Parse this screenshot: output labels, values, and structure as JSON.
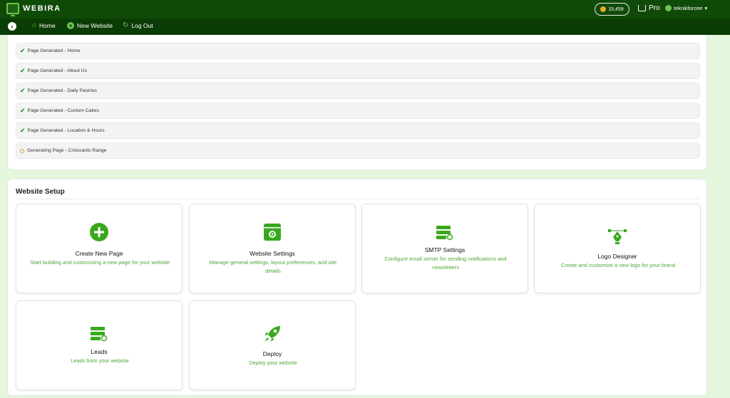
{
  "app": {
    "name": "WEBIRA",
    "credits": "15,459",
    "plan": "Pro",
    "username": "teknikforcee"
  },
  "nav": {
    "home": "Home",
    "new_website": "New Website",
    "logout": "Log Out"
  },
  "progress": [
    {
      "status": "done",
      "text": "Page Generated - Home"
    },
    {
      "status": "done",
      "text": "Page Generated - About Us"
    },
    {
      "status": "done",
      "text": "Page Generated - Daily Pastries"
    },
    {
      "status": "done",
      "text": "Page Generated - Custom Cakes"
    },
    {
      "status": "done",
      "text": "Page Generated - Location & Hours"
    },
    {
      "status": "pending",
      "text": "Generating Page - Croissants Range"
    }
  ],
  "setup": {
    "title": "Website Setup",
    "cards": [
      {
        "icon": "plus-circle-icon",
        "title": "Create New Page",
        "desc": "Start building and customizing a new page for your website"
      },
      {
        "icon": "settings-window-icon",
        "title": "Website Settings",
        "desc": "Manage general settings, layout preferences, and site details"
      },
      {
        "icon": "mail-server-icon",
        "title": "SMTP Settings",
        "desc": "Configure email server for sending notifications and newsletters"
      },
      {
        "icon": "pen-tool-icon",
        "title": "Logo Designer",
        "desc": "Create and customize a new logo for your brand"
      },
      {
        "icon": "server-icon",
        "title": "Leads",
        "desc": "Leads from your website"
      },
      {
        "icon": "rocket-icon",
        "title": "Deploy",
        "desc": "Deploy your website"
      }
    ]
  },
  "colors": {
    "topbar": "#0f4a08",
    "navbar": "#0a3d05",
    "accent": "#3aa81e",
    "page_bg": "#e4f6dc"
  }
}
